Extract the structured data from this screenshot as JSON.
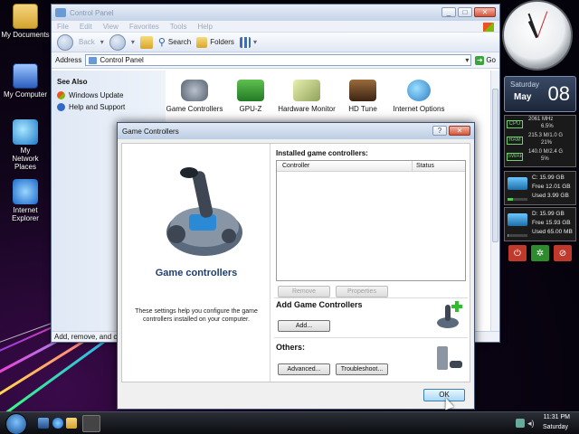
{
  "desktop": {
    "icons": [
      {
        "label": "My Documents"
      },
      {
        "label": "My Computer"
      },
      {
        "label": "My Network Places"
      },
      {
        "label": "Internet Explorer"
      }
    ]
  },
  "control_panel": {
    "title": "Control Panel",
    "menu": [
      "File",
      "Edit",
      "View",
      "Favorites",
      "Tools",
      "Help"
    ],
    "toolbar": {
      "back": "Back",
      "search": "Search",
      "folders": "Folders"
    },
    "address": {
      "label": "Address",
      "value": "Control Panel",
      "go": "Go"
    },
    "sidebar": {
      "heading": "See Also",
      "links": [
        "Windows Update",
        "Help and Support"
      ]
    },
    "items": [
      "Game Controllers",
      "GPU-Z",
      "Hardware Monitor",
      "HD Tune",
      "Internet Options"
    ],
    "status": "Add, remove, and con"
  },
  "dialog": {
    "title": "Game Controllers",
    "heading": "Game controllers",
    "description": "These settings help you configure the game controllers installed on your computer.",
    "installed_label": "Installed game controllers:",
    "columns": [
      "Controller",
      "Status"
    ],
    "remove": "Remove",
    "properties": "Properties",
    "add_heading": "Add Game Controllers",
    "add": "Add...",
    "others_heading": "Others:",
    "advanced": "Advanced...",
    "troubleshoot": "Troubleshoot...",
    "ok": "OK"
  },
  "gadgets": {
    "date": {
      "weekday": "Saturday",
      "month": "May",
      "day": "08"
    },
    "cpu": {
      "label": "CPU",
      "freq": "2061 MHz",
      "usage": "6.5%"
    },
    "ram": {
      "label": "RAM",
      "value": "215.3 M/1.0 G",
      "usage": "21%"
    },
    "swap": {
      "label": "SWAP",
      "value": "140.0 M/2.4 G",
      "usage": "5%"
    },
    "drive_c": {
      "name": "C:",
      "total": "15.99 GB",
      "free": "Free 12.01 GB",
      "used": "Used 3.99 GB",
      "used_fraction": 0.25
    },
    "drive_d": {
      "name": "D:",
      "total": "15.99 GB",
      "free": "Free 15.93 GB",
      "used": "Used 65.00 MB",
      "used_fraction": 0.01
    }
  },
  "taskbar": {
    "time": "11:31 PM",
    "weekday": "Saturday"
  }
}
